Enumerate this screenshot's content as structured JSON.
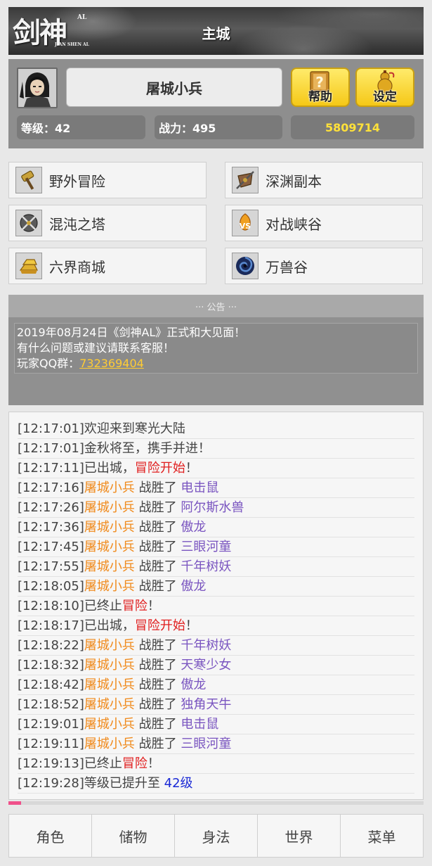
{
  "header": {
    "logo_main": "剑神",
    "logo_sup": "AL",
    "logo_sub": "JIAN SHEN AL",
    "title": "主城"
  },
  "player": {
    "name": "屠城小兵",
    "level_label": "等级：42",
    "power_label": "战力：495",
    "gold": "5809714",
    "help_label": "帮助",
    "settings_label": "设定"
  },
  "menu": {
    "items": [
      {
        "label": "野外冒险",
        "icon": "hammer-icon"
      },
      {
        "label": "深渊副本",
        "icon": "sword-shield-icon"
      },
      {
        "label": "混沌之塔",
        "icon": "crossed-blades-icon"
      },
      {
        "label": "对战峡谷",
        "icon": "vs-icon"
      },
      {
        "label": "六界商城",
        "icon": "gold-bars-icon"
      },
      {
        "label": "万兽谷",
        "icon": "vortex-icon"
      }
    ]
  },
  "announcement": {
    "header": "··· 公告 ···",
    "line1": "2019年08月24日《剑神AL》正式和大见面！",
    "line2": "有什么问题或建议请联系客服！",
    "line3_prefix": "玩家QQ群：",
    "qq_group": "732369404"
  },
  "log": {
    "lines": [
      {
        "time": "[12:17:01]",
        "text": "欢迎来到寒光大陆"
      },
      {
        "time": "[12:17:01]",
        "text": "金秋将至，携手并进！"
      },
      {
        "time": "[12:17:11]",
        "text": "已出城，",
        "highlight": "冒险开始",
        "suffix": "！"
      },
      {
        "time": "[12:17:16]",
        "player": "屠城小兵",
        "verb": " 战胜了 ",
        "target": "电击鼠"
      },
      {
        "time": "[12:17:26]",
        "player": "屠城小兵",
        "verb": " 战胜了 ",
        "target": "阿尔斯水兽"
      },
      {
        "time": "[12:17:36]",
        "player": "屠城小兵",
        "verb": " 战胜了 ",
        "target": "傲龙"
      },
      {
        "time": "[12:17:45]",
        "player": "屠城小兵",
        "verb": " 战胜了 ",
        "target": "三眼河童"
      },
      {
        "time": "[12:17:55]",
        "player": "屠城小兵",
        "verb": " 战胜了 ",
        "target": "千年树妖"
      },
      {
        "time": "[12:18:05]",
        "player": "屠城小兵",
        "verb": " 战胜了 ",
        "target": "傲龙"
      },
      {
        "time": "[12:18:10]",
        "text": "已终止",
        "highlight": "冒险",
        "suffix": "！"
      },
      {
        "time": "[12:18:17]",
        "text": "已出城，",
        "highlight": "冒险开始",
        "suffix": "！"
      },
      {
        "time": "[12:18:22]",
        "player": "屠城小兵",
        "verb": " 战胜了 ",
        "target": "千年树妖"
      },
      {
        "time": "[12:18:32]",
        "player": "屠城小兵",
        "verb": " 战胜了 ",
        "target": "天寒少女"
      },
      {
        "time": "[12:18:42]",
        "player": "屠城小兵",
        "verb": " 战胜了 ",
        "target": "傲龙"
      },
      {
        "time": "[12:18:52]",
        "player": "屠城小兵",
        "verb": " 战胜了 ",
        "target": "独角天牛"
      },
      {
        "time": "[12:19:01]",
        "player": "屠城小兵",
        "verb": " 战胜了 ",
        "target": "电击鼠"
      },
      {
        "time": "[12:19:11]",
        "player": "屠城小兵",
        "verb": " 战胜了 ",
        "target": "三眼河童"
      },
      {
        "time": "[12:19:13]",
        "text": "已终止",
        "highlight": "冒险",
        "suffix": "！"
      },
      {
        "time": "[12:19:28]",
        "text": "等级已提升至 ",
        "level": "42级"
      }
    ]
  },
  "progress": {
    "value_fraction": 0.03,
    "color": "#f0508a"
  },
  "nav": {
    "tabs": [
      "角色",
      "储物",
      "身法",
      "世界",
      "菜单"
    ]
  },
  "colors": {
    "player_name": "#f08a1c",
    "monster": "#7a55c0",
    "adventure": "#e01e1e",
    "level_up": "#1b2ad6",
    "gold": "#ffe13a"
  }
}
